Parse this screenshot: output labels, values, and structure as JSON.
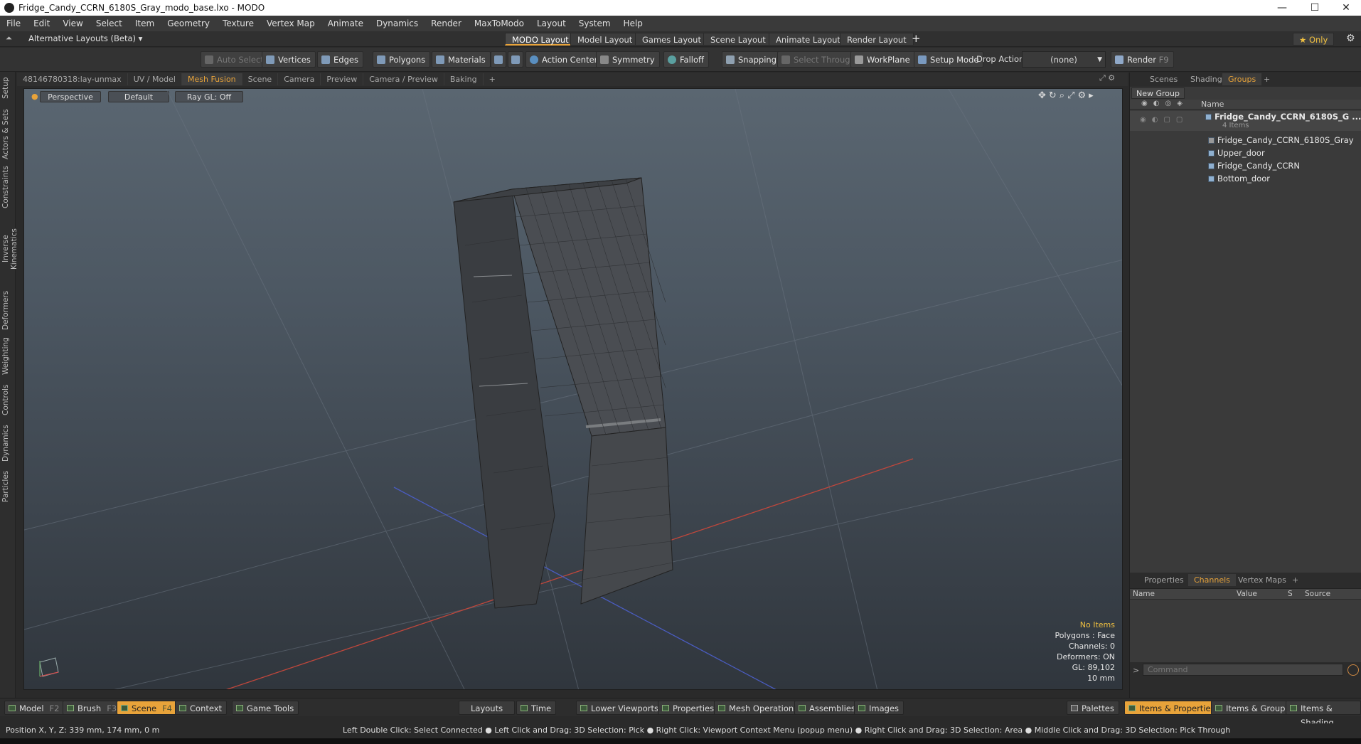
{
  "window": {
    "title": "Fridge_Candy_CCRN_6180S_Gray_modo_base.lxo - MODO",
    "minimize_glyph": "—",
    "maximize_glyph": "☐",
    "close_glyph": "✕"
  },
  "menu": [
    "File",
    "Edit",
    "View",
    "Select",
    "Item",
    "Geometry",
    "Texture",
    "Vertex Map",
    "Animate",
    "Dynamics",
    "Render",
    "MaxToModo",
    "Layout",
    "System",
    "Help"
  ],
  "layout_bar": {
    "selector": "Alternative Layouts (Beta) ▾",
    "tabs": [
      "MODO Layout",
      "Model Layout",
      "Games Layout",
      "Scene Layout",
      "Animate Layout",
      "Render Layout"
    ],
    "active_tab": "MODO Layout",
    "add": "+",
    "only": "★  Only"
  },
  "toolbar": {
    "auto_select": "Auto Select",
    "vertices": "Vertices",
    "edges": "Edges",
    "polygons": "Polygons",
    "materials": "Materials",
    "action_center": "Action Center",
    "symmetry": "Symmetry",
    "falloff": "Falloff",
    "snapping": "Snapping",
    "select_through": "Select Through",
    "workplane": "WorkPlane",
    "setup_mode": "Setup Mode",
    "drop_action_label": "Drop Action",
    "drop_action_value": "(none)",
    "render": "Render",
    "render_key": "F9"
  },
  "left_tabs": [
    "Setup",
    "Actors & Sets",
    "Constraints",
    "Inverse Kinematics",
    "Deformers",
    "Weighting",
    "Controls",
    "Dynamics",
    "Particles"
  ],
  "viewport_tabs": [
    "48146780318:lay-unmax",
    "UV / Model",
    "Mesh Fusion",
    "Scene",
    "Camera",
    "Preview",
    "Camera / Preview",
    "Baking",
    "+"
  ],
  "viewport_active_tab": "Mesh Fusion",
  "viewport": {
    "view": "Perspective",
    "shading": "Default",
    "raygl": "Ray GL: Off",
    "hud": {
      "no_items": "No Items",
      "polygons": "Polygons : Face",
      "channels": "Channels: 0",
      "deformers": "Deformers: ON",
      "gl": "GL: 89,102",
      "scale": "10 mm"
    }
  },
  "right_panel": {
    "tabs": [
      "Scenes",
      "Shading",
      "Groups",
      "+"
    ],
    "active_tab": "Groups",
    "new_group": "New Group",
    "name_col": "Name",
    "group_name": "Fridge_Candy_CCRN_6180S_G ...",
    "group_count": "4 Items",
    "items": [
      "Fridge_Candy_CCRN_6180S_Gray",
      "Upper_door",
      "Fridge_Candy_CCRN",
      "Bottom_door"
    ]
  },
  "channels_panel": {
    "tabs": [
      "Properties",
      "Channels",
      "Vertex Maps",
      "+"
    ],
    "active_tab": "Channels",
    "columns": [
      "Name",
      "Value",
      "S",
      "Source"
    ],
    "command_placeholder": "Command"
  },
  "bottom_bar": {
    "model": "Model",
    "model_key": "F2",
    "brush": "Brush",
    "brush_key": "F3",
    "scene": "Scene",
    "scene_key": "F4",
    "context": "Context",
    "game_tools": "Game Tools",
    "layouts": "Layouts",
    "time": "Time",
    "lower_viewports": "Lower Viewports",
    "properties": "Properties",
    "mesh_operations": "Mesh Operations",
    "assemblies": "Assemblies",
    "images": "Images",
    "palettes": "Palettes",
    "items_properties": "Items & Properties",
    "items_groups": "Items & Groups",
    "items_shading": "Items & Shading"
  },
  "status": {
    "position": "Position X, Y, Z:   339 mm, 174 mm, 0 m",
    "hints": "Left Double Click: Select Connected ● Left Click and Drag: 3D Selection: Pick ● Right Click: Viewport Context Menu (popup menu) ● Right Click and Drag: 3D Selection: Area ● Middle Click and Drag: 3D Selection: Pick Through"
  }
}
